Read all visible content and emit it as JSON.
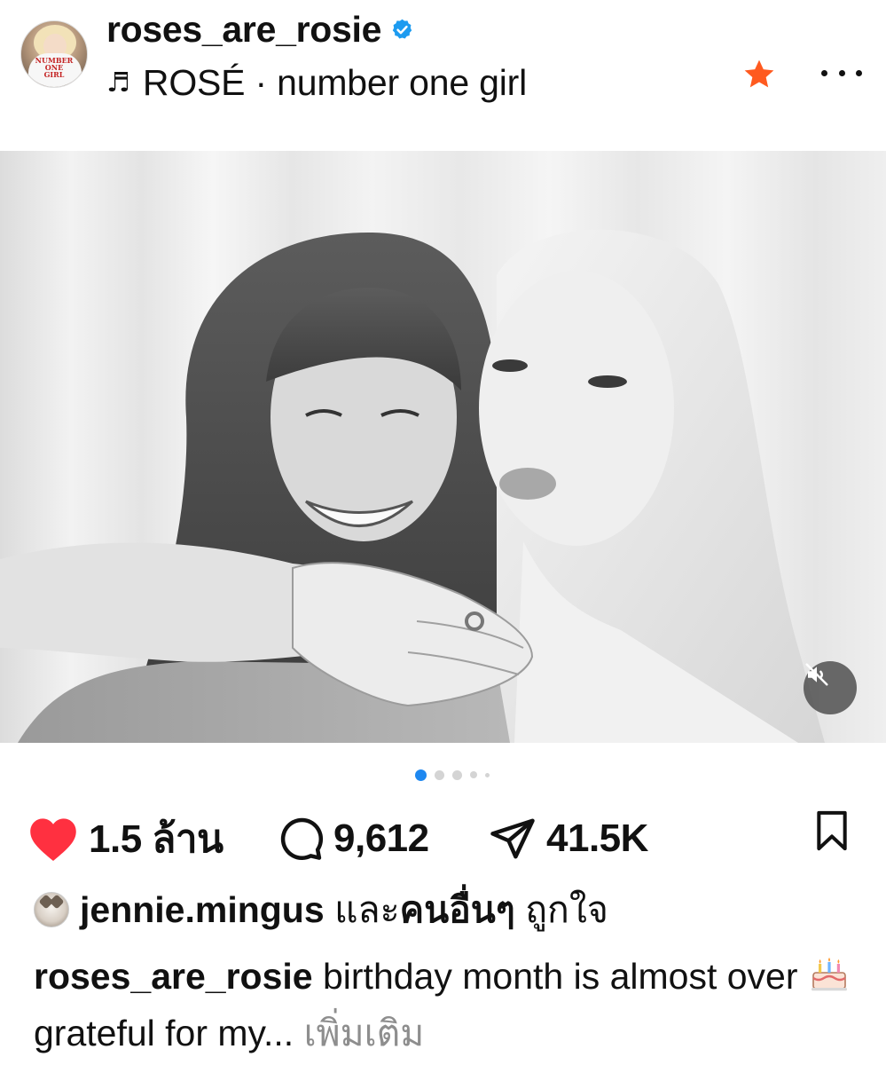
{
  "header": {
    "username": "roses_are_rosie",
    "music_note": "♬",
    "music_text": "ROSÉ · number one girl",
    "avatar_shirt_text": "NUMBER\nONE\nGIRL",
    "colors": {
      "verified": "#1d9bf0",
      "star": "#ff5a1f"
    }
  },
  "post": {
    "carousel": {
      "total": 5,
      "active_index": 0
    },
    "mute_icon": "speaker-muted-icon"
  },
  "actions": {
    "likes": "1.5 ล้าน",
    "comments": "9,612",
    "shares": "41.5K",
    "colors": {
      "like": "#ff3040"
    }
  },
  "liked_by": {
    "user": "jennie.mingus",
    "connector": "และ",
    "others": "คนอื่นๆ",
    "suffix": "ถูกใจ"
  },
  "caption": {
    "user": "roses_are_rosie",
    "text_1": "birthday month is almost over",
    "text_2": "grateful for my...",
    "more": "เพิ่มเติม"
  }
}
